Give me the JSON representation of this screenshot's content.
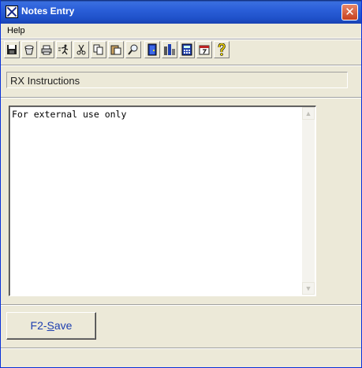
{
  "window": {
    "title": "Notes Entry",
    "close_glyph": "✕"
  },
  "menu": {
    "help_label": "Help"
  },
  "toolbar": {
    "buttons": [
      {
        "icon": "save-disk-icon",
        "glyph": "▪"
      },
      {
        "icon": "bucket-icon",
        "glyph": "◒"
      },
      {
        "icon": "printer-icon",
        "glyph": "⎙"
      },
      {
        "icon": "run-icon",
        "glyph": "⇶"
      },
      {
        "icon": "scissors-icon",
        "glyph": "✂"
      },
      {
        "icon": "copy-icon",
        "glyph": "❐"
      },
      {
        "icon": "paste-icon",
        "glyph": "▣"
      },
      {
        "icon": "magnifier-icon",
        "glyph": "⚲"
      },
      {
        "icon": "door-exit-icon",
        "glyph": "▮"
      },
      {
        "icon": "city-icon",
        "glyph": "⛫"
      },
      {
        "icon": "calculator-icon",
        "glyph": "▦"
      },
      {
        "icon": "calendar-icon",
        "glyph": "▤"
      },
      {
        "icon": "help-question-icon",
        "glyph": "?"
      }
    ]
  },
  "section": {
    "label": "RX Instructions"
  },
  "notes": {
    "text": "For external use only"
  },
  "scrollbar": {
    "up_glyph": "▲",
    "down_glyph": "▼"
  },
  "footer": {
    "save_prefix": "F2-",
    "save_underlined": "S",
    "save_suffix": "ave"
  },
  "colors": {
    "title_bar": "#2b5fd9",
    "window_bg": "#ece9d8",
    "save_text": "#1e3fb0"
  }
}
